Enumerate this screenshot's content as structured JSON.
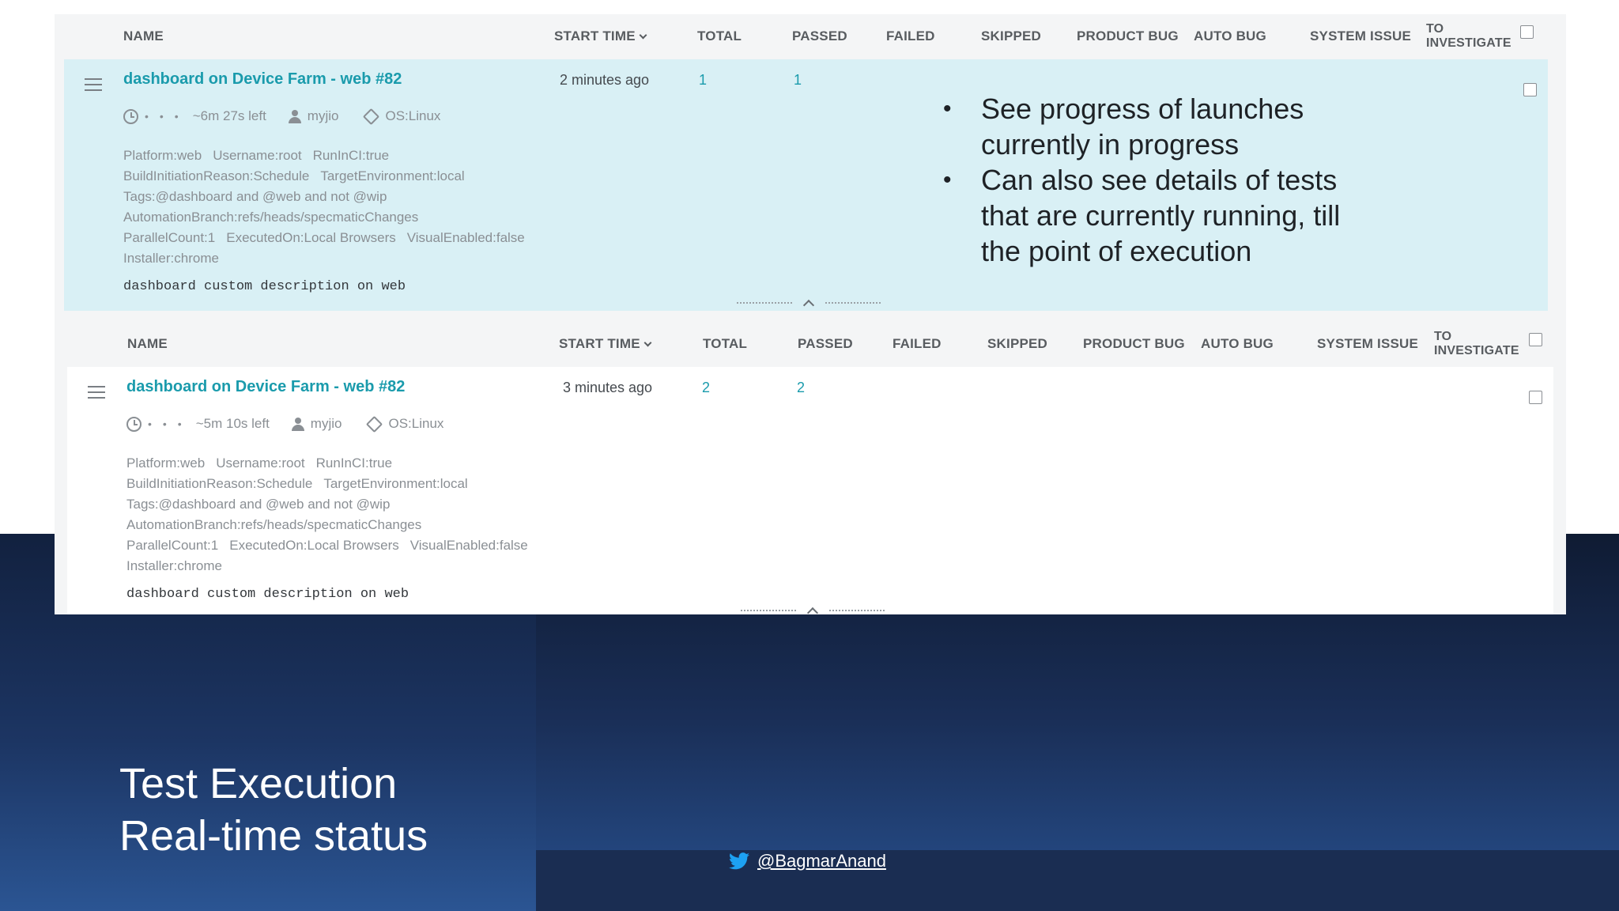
{
  "columns": {
    "name": "NAME",
    "start_time": "START TIME",
    "total": "TOTAL",
    "passed": "PASSED",
    "failed": "FAILED",
    "skipped": "SKIPPED",
    "product_bug": "PRODUCT BUG",
    "auto_bug": "AUTO BUG",
    "system_issue": "SYSTEM ISSUE",
    "to_investigate_1": "TO",
    "to_investigate_2": "INVESTIGATE"
  },
  "launches": [
    {
      "name": "dashboard on Device Farm - web #82",
      "start_time": "2 minutes ago",
      "total": "1",
      "passed": "1",
      "time_left": "~6m 27s left",
      "owner": "myjio",
      "os": "OS:Linux",
      "attributes": [
        [
          "Platform:web",
          "Username:root",
          "RunInCI:true"
        ],
        [
          "BuildInitiationReason:Schedule",
          "TargetEnvironment:local"
        ],
        [
          "Tags:@dashboard and @web and not @wip"
        ],
        [
          "AutomationBranch:refs/heads/specmaticChanges"
        ],
        [
          "ParallelCount:1",
          "ExecutedOn:Local Browsers",
          "VisualEnabled:false"
        ],
        [
          "Installer:chrome"
        ]
      ],
      "description": "dashboard custom description on web"
    },
    {
      "name": "dashboard on Device Farm - web #82",
      "start_time": "3 minutes ago",
      "total": "2",
      "passed": "2",
      "time_left": "~5m 10s left",
      "owner": "myjio",
      "os": "OS:Linux",
      "attributes": [
        [
          "Platform:web",
          "Username:root",
          "RunInCI:true"
        ],
        [
          "BuildInitiationReason:Schedule",
          "TargetEnvironment:local"
        ],
        [
          "Tags:@dashboard and @web and not @wip"
        ],
        [
          "AutomationBranch:refs/heads/specmaticChanges"
        ],
        [
          "ParallelCount:1",
          "ExecutedOn:Local Browsers",
          "VisualEnabled:false"
        ],
        [
          "Installer:chrome"
        ]
      ],
      "description": "dashboard custom description on web"
    }
  ],
  "bullets": [
    "See progress of launches currently in progress",
    "Can also see details of tests that are currently running, till the point of execution"
  ],
  "slide": {
    "title_line1": "Test Execution",
    "title_line2": "Real-time status",
    "twitter_handle": "@BagmarAnand"
  },
  "colors": {
    "link": "#1a9bac",
    "highlight_row": "#d9f0f5",
    "twitter_blue": "#1da1f2"
  }
}
